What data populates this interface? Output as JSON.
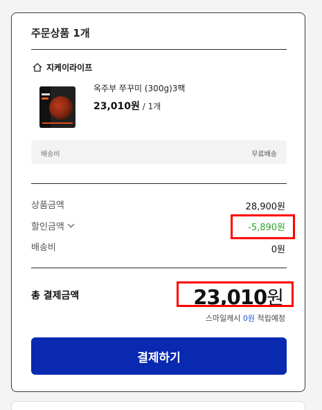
{
  "order": {
    "title": "주문상품 1개",
    "seller": "지케이라이프",
    "product": {
      "name": "옥주부 쭈꾸미 (300g)3팩",
      "price": "23,010",
      "price_unit": "원",
      "quantity": " / 1개"
    },
    "shipping_box": {
      "label": "배송비",
      "value": "무료배송"
    }
  },
  "summary": {
    "product_amount_label": "상품금액",
    "product_amount_value": "28,900원",
    "discount_label": "할인금액",
    "discount_value": "-5,890원",
    "shipping_label": "배송비",
    "shipping_value": "0원"
  },
  "total": {
    "label": "총 결제금액",
    "amount": "23,010",
    "unit": "원"
  },
  "points": {
    "prefix": "스마일캐시 ",
    "amount": "0원",
    "suffix": " 적립예정"
  },
  "pay_button": {
    "label": "결제하기"
  },
  "colors": {
    "button_bg": "#0829b0",
    "discount": "#2ea32e",
    "points": "#1a55d6",
    "highlight_box": "#ff0000"
  },
  "icons": {
    "seller": "home-icon",
    "discount_toggle": "chevron-down-icon"
  }
}
